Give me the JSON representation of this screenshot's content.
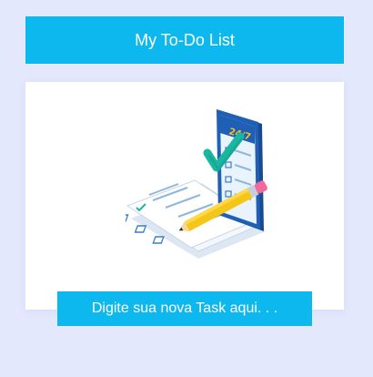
{
  "header": {
    "title": "My To-Do List"
  },
  "hero": {
    "phone_badge": "24/7"
  },
  "task_input": {
    "placeholder": "Digite sua nova Task aqui. . .",
    "value": ""
  },
  "colors": {
    "background": "#e4e8fd",
    "accent": "#0db8ef",
    "card": "#ffffff",
    "phone": "#1f5fb5",
    "check": "#19b7a2",
    "pencil": "#f5c518",
    "eraser": "#f06a9a"
  },
  "icons": {
    "hero": "todo-checklist-illustration",
    "check": "check-icon",
    "pencil": "pencil-icon"
  }
}
